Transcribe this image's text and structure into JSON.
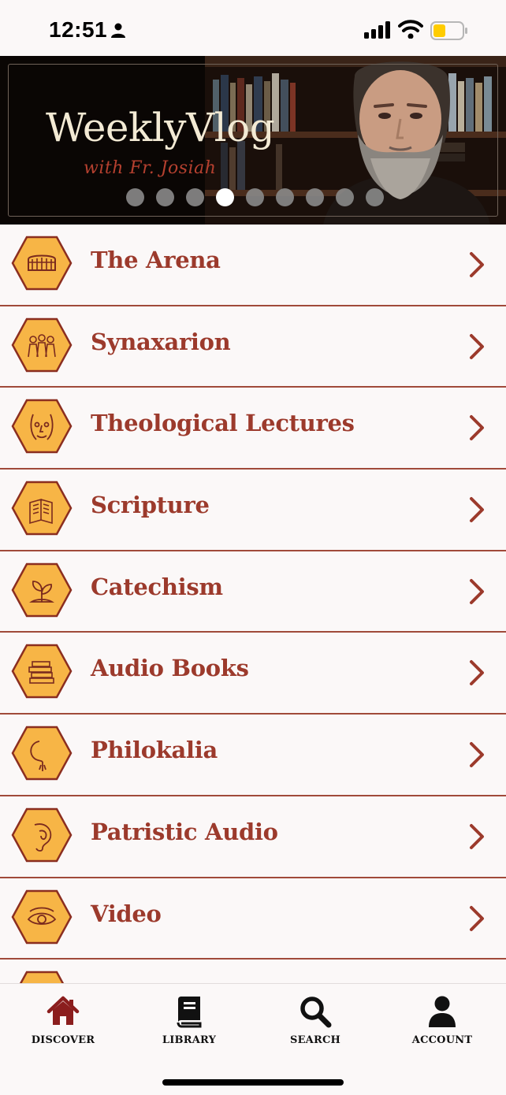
{
  "status_bar": {
    "time": "12:51",
    "battery_color": "#ffcc00"
  },
  "banner": {
    "title": "WeeklyVlog",
    "subtitle": "with Fr. Josiah",
    "slide_count": 9,
    "active_slide_index": 3
  },
  "accent_color": "#9c3a2c",
  "hex_fill_color": "#f7b546",
  "categories": [
    {
      "label": "The Arena",
      "icon": "colosseum-icon"
    },
    {
      "label": "Synaxarion",
      "icon": "saints-icon"
    },
    {
      "label": "Theological Lectures",
      "icon": "face-icon"
    },
    {
      "label": "Scripture",
      "icon": "scripture-icon"
    },
    {
      "label": "Catechism",
      "icon": "sprout-icon"
    },
    {
      "label": "Audio Books",
      "icon": "books-icon"
    },
    {
      "label": "Philokalia",
      "icon": "prayer-rope-icon"
    },
    {
      "label": "Patristic Audio",
      "icon": "ear-icon"
    },
    {
      "label": "Video",
      "icon": "eye-icon"
    }
  ],
  "tab_bar": {
    "tabs": [
      {
        "label": "DISCOVER",
        "icon": "home-icon",
        "active": true
      },
      {
        "label": "LIBRARY",
        "icon": "book-icon",
        "active": false
      },
      {
        "label": "SEARCH",
        "icon": "magnifier-icon",
        "active": false
      },
      {
        "label": "ACCOUNT",
        "icon": "person-icon",
        "active": false
      }
    ]
  }
}
